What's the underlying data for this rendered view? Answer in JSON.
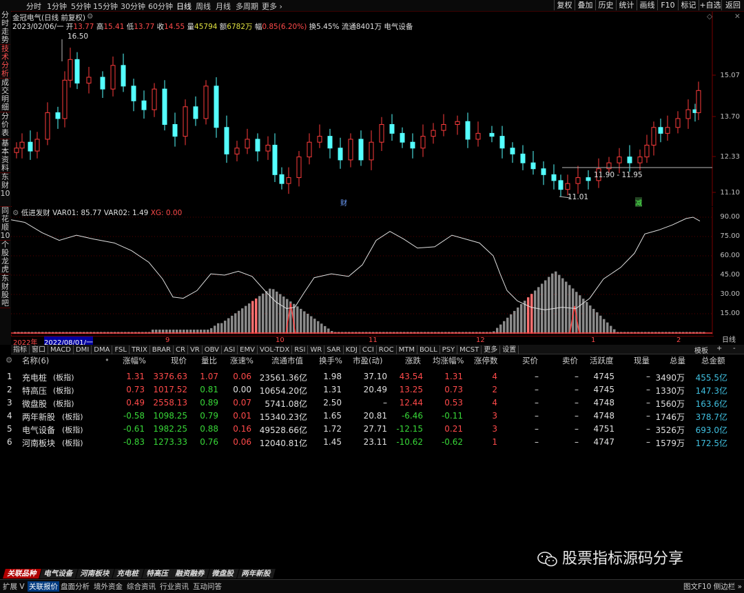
{
  "topbar": {
    "period_tabs": [
      "分时",
      "1分钟",
      "5分钟",
      "15分钟",
      "30分钟",
      "60分钟",
      "日线",
      "周线",
      "月线",
      "多周期",
      "更多 ›"
    ],
    "active_tab": "日线",
    "right_buttons": [
      "复权",
      "叠加",
      "历史",
      "统计",
      "画线",
      "F10",
      "标记",
      "+自选",
      "返回"
    ]
  },
  "leftbar": {
    "tabs": [
      "分时走势",
      "技术分析",
      "成交明细",
      "分价表",
      "基本资料",
      "东财10",
      "同花顺10",
      "个股龙虎",
      "东财股吧"
    ],
    "active": "技术分析"
  },
  "main_chart": {
    "title": "金冠电气(日线 前复权)",
    "date": "2023/02/06/一",
    "open_label": "开",
    "open": "13.77",
    "high_label": "高",
    "high": "15.41",
    "low_label": "低",
    "low": "13.77",
    "close_label": "收",
    "close": "14.55",
    "volume_label": "量",
    "volume": "45794",
    "amount_label": "额",
    "amount": "6782万",
    "change_label": "幅",
    "change": "0.85(6.20%)",
    "turnover": "换5.45%",
    "float": "流通8401万",
    "sector": "电气设备",
    "price_ticks": [
      "15.07",
      "13.70",
      "12.33",
      "11.10"
    ],
    "annotations": [
      "16.50",
      "11.01",
      "11.90 - 11.95"
    ],
    "markers": [
      "财",
      "减"
    ]
  },
  "indicator": {
    "title": "低进发财",
    "var01": "VAR01: 85.77",
    "var02": "VAR02: 1.49",
    "xg": "XG: 0.00",
    "ticks": [
      "90.00",
      "75.00",
      "60.00",
      "45.00",
      "30.00",
      "15.00"
    ]
  },
  "datebar": {
    "items": [
      "2022年",
      "2022/08/01/一",
      "9",
      "10",
      "11",
      "12",
      "1",
      "2"
    ],
    "line_label": "日线"
  },
  "indicator_tabs": [
    "指标",
    "窗口",
    "MACD",
    "DMI",
    "DMA",
    "FSL",
    "TRIX",
    "BRAR",
    "CR",
    "VR",
    "OBV",
    "ASI",
    "EMV",
    "VOL-TDX",
    "RSI",
    "WR",
    "SAR",
    "KDJ",
    "CCI",
    "ROC",
    "MTM",
    "BOLL",
    "PSY",
    "MCST",
    "更多",
    "设置"
  ],
  "indicator_tabs_right": [
    "模板",
    "+",
    "-"
  ],
  "table": {
    "headers": [
      "名称(6)",
      "涨幅%",
      "现价",
      "量比",
      "涨速%",
      "流通市值",
      "换手%",
      "市盈(动)",
      "涨跌",
      "均涨幅%",
      "涨停数",
      "买价",
      "卖价",
      "活跃度",
      "现量",
      "总量",
      "总金额"
    ],
    "rows": [
      {
        "idx": "1",
        "name": "充电桩",
        "tag": "(板指)",
        "chg": "1.31",
        "price": "3376.63",
        "vr": "1.07",
        "spd": "0.06",
        "mcap": "23561.36亿",
        "turn": "1.98",
        "pe": "37.10",
        "diff": "43.54",
        "avg": "1.31",
        "limit": "4",
        "bid": "–",
        "ask": "–",
        "act": "4745",
        "cur": "–",
        "vol": "3490万",
        "amt": "455.5亿",
        "dir": "up"
      },
      {
        "idx": "2",
        "name": "特高压",
        "tag": "(板指)",
        "chg": "0.73",
        "price": "1017.52",
        "vr": "0.81",
        "spd": "0.00",
        "mcap": "10654.20亿",
        "turn": "1.31",
        "pe": "20.49",
        "diff": "13.25",
        "avg": "0.73",
        "limit": "2",
        "bid": "–",
        "ask": "–",
        "act": "4745",
        "cur": "–",
        "vol": "1330万",
        "amt": "147.3亿",
        "dir": "up"
      },
      {
        "idx": "3",
        "name": "微盘股",
        "tag": "(板指)",
        "chg": "0.49",
        "price": "2558.13",
        "vr": "0.89",
        "spd": "0.07",
        "mcap": "5741.08亿",
        "turn": "2.50",
        "pe": "–",
        "diff": "12.44",
        "avg": "0.53",
        "limit": "4",
        "bid": "–",
        "ask": "–",
        "act": "4748",
        "cur": "–",
        "vol": "1560万",
        "amt": "163.6亿",
        "dir": "up"
      },
      {
        "idx": "4",
        "name": "两年新股",
        "tag": "(板指)",
        "chg": "-0.58",
        "price": "1098.25",
        "vr": "0.79",
        "spd": "0.01",
        "mcap": "15340.23亿",
        "turn": "1.65",
        "pe": "20.81",
        "diff": "-6.46",
        "avg": "-0.11",
        "limit": "3",
        "bid": "–",
        "ask": "–",
        "act": "4748",
        "cur": "–",
        "vol": "1746万",
        "amt": "378.7亿",
        "dir": "down"
      },
      {
        "idx": "5",
        "name": "电气设备",
        "tag": "(板指)",
        "chg": "-0.61",
        "price": "1982.25",
        "vr": "0.88",
        "spd": "0.16",
        "mcap": "49528.66亿",
        "turn": "1.72",
        "pe": "27.71",
        "diff": "-12.15",
        "avg": "0.21",
        "limit": "3",
        "bid": "–",
        "ask": "–",
        "act": "4751",
        "cur": "–",
        "vol": "3526万",
        "amt": "693.0亿",
        "dir": "down"
      },
      {
        "idx": "6",
        "name": "河南板块",
        "tag": "(板指)",
        "chg": "-0.83",
        "price": "1273.33",
        "vr": "0.76",
        "spd": "0.06",
        "mcap": "12040.81亿",
        "turn": "1.45",
        "pe": "23.11",
        "diff": "-10.62",
        "avg": "-0.62",
        "limit": "1",
        "bid": "–",
        "ask": "–",
        "act": "4747",
        "cur": "–",
        "vol": "1579万",
        "amt": "172.5亿",
        "dir": "down"
      }
    ]
  },
  "bottom_tabs": [
    "关联品种",
    "电气设备",
    "河南板块",
    "充电桩",
    "特高压",
    "融资融券",
    "微盘股",
    "两年新股"
  ],
  "statusbar": [
    "扩展 V",
    "关联报价",
    "盘面分析",
    "境外资金",
    "综合资讯",
    "行业资讯",
    "互动问答"
  ],
  "statusbar_right": "图文F10 侧边栏 »",
  "watermark": "股票指标源码分享",
  "colors": {
    "up": "#ff4a4a",
    "down": "#38d838",
    "candle_down": "#54ffff",
    "candle_up": "#ff3c3c",
    "bg": "#000000",
    "grid": "#5a0000"
  }
}
